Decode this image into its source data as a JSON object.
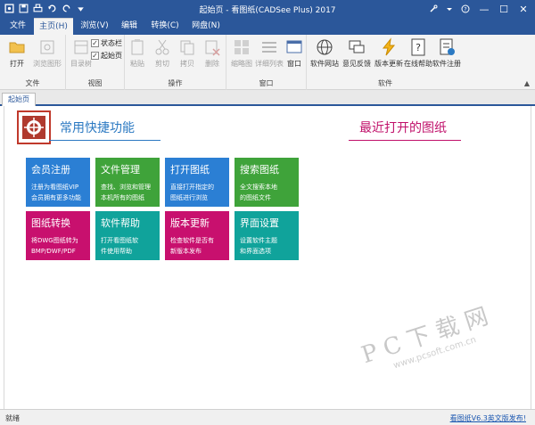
{
  "window": {
    "title": "起始页 - 看图纸(CADSee Plus) 2017",
    "min": "—",
    "max": "☐",
    "close": "✕"
  },
  "ribbon_tabs": [
    "文件",
    "主页(H)",
    "浏览(V)",
    "编辑",
    "转换(C)",
    "网盘(N)"
  ],
  "ribbon": {
    "file_group": {
      "label": "文件",
      "buttons": [
        "打开",
        "浏览图形"
      ]
    },
    "view_group": {
      "label": "视图",
      "buttons": [
        "目录树"
      ],
      "checks": [
        "状态栏",
        "起始页"
      ]
    },
    "ops_group": {
      "label": "操作",
      "buttons": [
        "粘贴",
        "剪切",
        "拷贝",
        "删除"
      ]
    },
    "window_group": {
      "label": "窗口",
      "buttons": [
        "缩略图",
        "详细列表",
        "窗口"
      ]
    },
    "software_group": {
      "label": "软件",
      "buttons": [
        "软件网站",
        "意见反馈",
        "版本更新",
        "在线帮助",
        "软件注册"
      ]
    }
  },
  "doc_tab": "起始页",
  "start_page": {
    "quick_title": "常用快捷功能",
    "recent_title": "最近打开的图纸",
    "tiles": [
      {
        "title": "会员注册",
        "line1": "注册为看图纸VIP",
        "line2": "会员拥有更多功能",
        "color": "#2b7fd4"
      },
      {
        "title": "文件管理",
        "line1": "查找、浏览和管理",
        "line2": "本机所有的图纸",
        "color": "#3fa33a"
      },
      {
        "title": "打开图纸",
        "line1": "直接打开指定的",
        "line2": "图纸进行浏览",
        "color": "#2b7fd4"
      },
      {
        "title": "搜索图纸",
        "line1": "全文搜索本地",
        "line2": "的图纸文件",
        "color": "#3fa33a"
      },
      {
        "title": "图纸转换",
        "line1": "将DWG图纸转为",
        "line2": "BMP/DWF/PDF",
        "color": "#c8106e"
      },
      {
        "title": "软件帮助",
        "line1": "打开看图纸软",
        "line2": "件使用帮助",
        "color": "#10a39b"
      },
      {
        "title": "版本更新",
        "line1": "检查软件是否有",
        "line2": "新版本发布",
        "color": "#c8106e"
      },
      {
        "title": "界面设置",
        "line1": "设置软件主题",
        "line2": "和界面选项",
        "color": "#10a39b"
      }
    ]
  },
  "watermark": {
    "big": "PC下载网",
    "small": "www.pcsoft.com.cn"
  },
  "status": {
    "text": "就绪",
    "link": "看图纸V6.3英文版发布!"
  }
}
